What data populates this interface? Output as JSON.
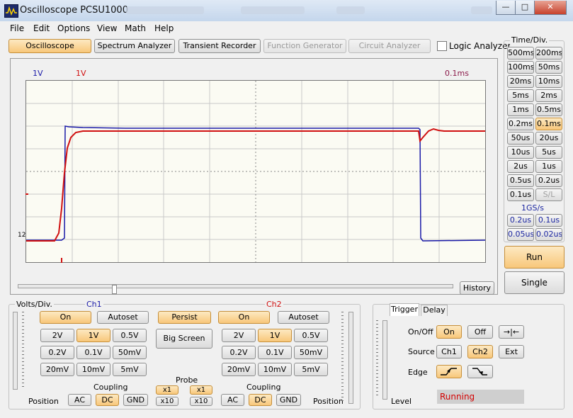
{
  "window": {
    "title": "Oscilloscope PCSU1000",
    "minimize": "—",
    "maximize": "□",
    "close": "✕"
  },
  "menu": [
    "File",
    "Edit",
    "Options",
    "View",
    "Math",
    "Help"
  ],
  "toolbar": {
    "oscilloscope": "Oscilloscope",
    "spectrum": "Spectrum Analyzer",
    "transient": "Transient Recorder",
    "function_gen": "Function Generator",
    "circuit": "Circuit Analyzer",
    "logic": "Logic Analyzer"
  },
  "scope": {
    "ch1_scale": "1V",
    "ch2_scale": "1V",
    "time_scale": "0.1ms",
    "history": "History",
    "marker": "12"
  },
  "timediv": {
    "title": "Time/Div.",
    "buttons": [
      "500ms",
      "200ms",
      "100ms",
      "50ms",
      "20ms",
      "10ms",
      "5ms",
      "2ms",
      "1ms",
      "0.5ms",
      "0.2ms",
      "0.1ms",
      "50us",
      "20us",
      "10us",
      "5us",
      "2us",
      "1us",
      "0.5us",
      "0.2us",
      "0.1us",
      "S/L"
    ],
    "gs_label": "1GS/s",
    "fast": [
      "0.2us",
      "0.1us",
      "0.05us",
      "0.02us"
    ],
    "run": "Run",
    "single": "Single"
  },
  "voltsdiv": {
    "title": "Volts/Div.",
    "ch1": "Ch1",
    "ch2": "Ch2",
    "on": "On",
    "autoset": "Autoset",
    "persist": "Persist",
    "big_screen": "Big Screen",
    "volts": [
      "2V",
      "1V",
      "0.5V",
      "0.2V",
      "0.1V",
      "50mV",
      "20mV",
      "10mV",
      "5mV"
    ],
    "coupling": "Coupling",
    "ac": "AC",
    "dc": "DC",
    "gnd": "GND",
    "probe": "Probe",
    "x1": "x1",
    "x10": "x10",
    "position": "Position"
  },
  "trigger": {
    "tab_trigger": "Trigger",
    "tab_delay": "Delay",
    "onoff": "On/Off",
    "on": "On",
    "off": "Off",
    "expand": "→|←",
    "source": "Source",
    "ch1": "Ch1",
    "ch2": "Ch2",
    "ext": "Ext",
    "edge": "Edge",
    "level": "Level",
    "status": "Running"
  },
  "colors": {
    "ch1": "#1a1aa8",
    "ch2": "#d01010",
    "accent": "#f8c77a"
  }
}
